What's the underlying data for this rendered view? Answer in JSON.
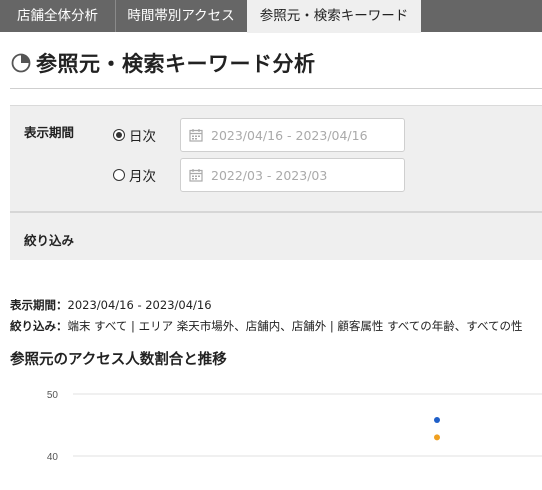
{
  "tabs": [
    {
      "label": "店舗全体分析"
    },
    {
      "label": "時間帯別アクセス"
    },
    {
      "label": "参照元・検索キーワード",
      "active": true
    }
  ],
  "page": {
    "title": "参照元・検索キーワード分析",
    "title_icon": "pie-chart-icon"
  },
  "filter": {
    "period_label": "表示期間",
    "daily_label": "日次",
    "daily_selected": true,
    "daily_range": "2023/04/16 - 2023/04/16",
    "monthly_label": "月次",
    "monthly_selected": false,
    "monthly_range": "2022/03 - 2023/03",
    "calendar_icon": "calendar-icon",
    "narrow_label": "絞り込み"
  },
  "summary": {
    "period_key": "表示期間：",
    "period_value": "2023/04/16 - 2023/04/16",
    "filter_key": "絞り込み：",
    "filter_value": "端末 すべて | エリア 楽天市場外、店舗内、店舗外 | 顧客属性 すべての年齢、すべての性"
  },
  "chart_section": {
    "title": "参照元のアクセス人数割合と推移"
  },
  "chart_data": {
    "type": "line",
    "y_ticks": [
      50,
      40
    ],
    "series": [
      {
        "color": "#1f5fc8",
        "values": [
          45.8
        ]
      },
      {
        "color": "#f0a020",
        "values": [
          43.0
        ]
      }
    ],
    "grid": true
  },
  "colors": {
    "tab_bar": "#666666",
    "tab_active_bg": "#efefef",
    "panel_bg": "#efefef"
  }
}
